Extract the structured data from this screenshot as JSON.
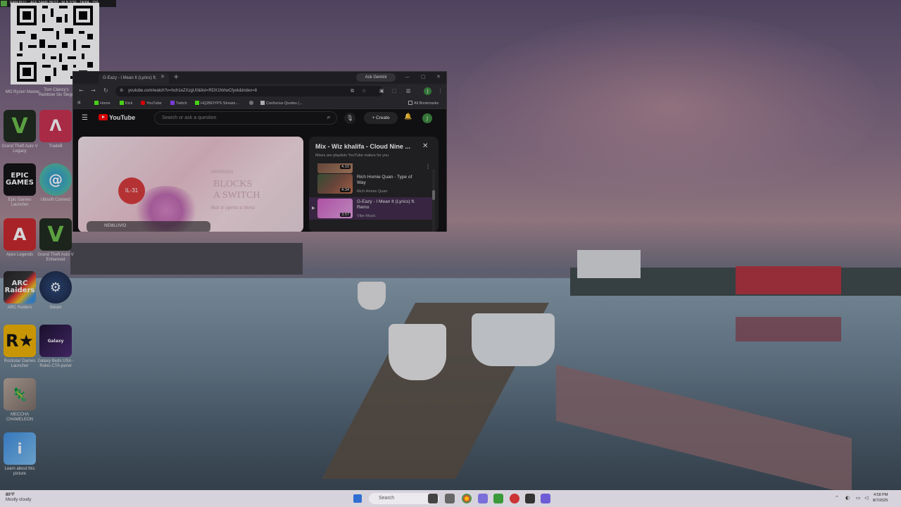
{
  "status_strip": {
    "label": "RAM PULL · AEE SAME BEST · NI B TOR · TAIPA · 150"
  },
  "desktop_icons": [
    {
      "label": "Recycle Bin"
    },
    {
      "label": "MO Ryzen Master"
    },
    {
      "label": "Tom Clancy's Rainbow Six Siege"
    },
    {
      "label": "Grand Theft Auto V Legacy"
    },
    {
      "label": "TradeB"
    },
    {
      "label": "Epic Games Launcher"
    },
    {
      "label": "Ubisoft Connect"
    },
    {
      "label": "Apex Legends"
    },
    {
      "label": "Grand Theft Auto V Enhanced"
    },
    {
      "label": "ARC Raiders"
    },
    {
      "label": "Steam"
    },
    {
      "label": "Rockstar Games Launcher"
    },
    {
      "label": "Galaxy Beds USA - Roles CTA-panel"
    },
    {
      "label": "MECCHA CHAMELEON"
    },
    {
      "label": "Learn about this picture"
    }
  ],
  "browser": {
    "tab_title": "G-Eazy - I Mean It (Lyrics) ft.",
    "gemini": "Ask Gemini",
    "url": "youtube.com/watch?v=hch1eZXzgU0&list=RDX1NrIwCfyxk&index=8",
    "bookmarks": [
      "Home",
      "Kick",
      "YouTube",
      "Twitch",
      "HQ2BOYPS Stream...",
      "Confucius Quotes (...",
      "All Bookmarks"
    ],
    "avatar_letter": "J"
  },
  "youtube": {
    "logo": "YouTube",
    "search_placeholder": "Search or ask a question",
    "create": "Create",
    "avatar_letter": "J",
    "player": {
      "badge": "IL-31",
      "brand": "nemluvio",
      "headline_1": "BLOCKS",
      "headline_2": "A SWITCH",
      "script": "that it opens a mess",
      "channel": "NEMLUVIO"
    },
    "playlist": {
      "title": "Mix - Wiz khalifa - Cloud Nine ...",
      "subtitle": "Mixes are playlists YouTube makes for you",
      "items": [
        {
          "title": "",
          "channel": "",
          "duration": "4:10"
        },
        {
          "title": "Rich Homie Quan - Type of Way",
          "channel": "Rich Homie Quan",
          "duration": "4:34"
        },
        {
          "title": "G-Eazy - I Mean It (Lyrics) ft. Remo",
          "channel": "Vibe Music",
          "duration": "3:57"
        }
      ]
    }
  },
  "taskbar": {
    "weather_temp": "80°F",
    "weather_desc": "Mostly cloudy",
    "search": "Search",
    "time": "4:58 PM",
    "date": "8/7/2025"
  },
  "colors": {
    "youtube_red": "#ff0000",
    "active_item": "#3f2a4a",
    "avatar_green": "#3b8a3e"
  }
}
